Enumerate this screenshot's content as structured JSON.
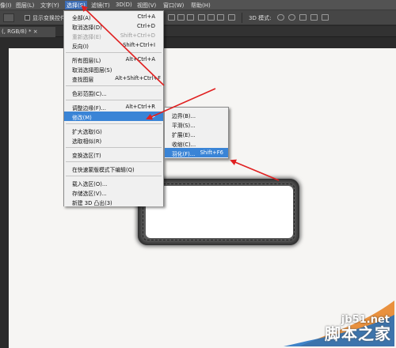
{
  "menubar": {
    "items": [
      {
        "label": "像(I)",
        "active": false
      },
      {
        "label": "图层(L)",
        "active": false
      },
      {
        "label": "文字(Y)",
        "active": false
      },
      {
        "label": "选择(S)",
        "active": true
      },
      {
        "label": "滤镜(T)",
        "active": false
      },
      {
        "label": "3D(D)",
        "active": false
      },
      {
        "label": "视图(V)",
        "active": false
      },
      {
        "label": "窗口(W)",
        "active": false
      },
      {
        "label": "帮助(H)",
        "active": false
      }
    ]
  },
  "options": {
    "show_transform": "显示变换控件",
    "mode_3d": "3D 模式:"
  },
  "document": {
    "tab_label": "(, RGB/8) * ×"
  },
  "select_menu": {
    "items": [
      {
        "label": "全部(A)",
        "shortcut": "Ctrl+A",
        "disabled": false
      },
      {
        "label": "取消选择(D)",
        "shortcut": "Ctrl+D",
        "disabled": false
      },
      {
        "label": "重新选择(E)",
        "shortcut": "Shift+Ctrl+D",
        "disabled": true
      },
      {
        "label": "反向(I)",
        "shortcut": "Shift+Ctrl+I",
        "disabled": false
      },
      {
        "label": "所有图层(L)",
        "shortcut": "Alt+Ctrl+A",
        "disabled": false
      },
      {
        "label": "取消选择图层(S)",
        "shortcut": "",
        "disabled": false
      },
      {
        "label": "查找图层",
        "shortcut": "Alt+Shift+Ctrl+F",
        "disabled": false
      },
      {
        "label": "色彩范围(C)...",
        "shortcut": "",
        "disabled": false
      },
      {
        "label": "调整边缘(F)...",
        "shortcut": "Alt+Ctrl+R",
        "disabled": false
      },
      {
        "label": "修改(M)",
        "shortcut": "",
        "disabled": false,
        "highlighted": true
      },
      {
        "label": "扩大选取(G)",
        "shortcut": "",
        "disabled": false
      },
      {
        "label": "选取相似(R)",
        "shortcut": "",
        "disabled": false
      },
      {
        "label": "变换选区(T)",
        "shortcut": "",
        "disabled": false
      },
      {
        "label": "在快速蒙版模式下编辑(Q)",
        "shortcut": "",
        "disabled": false
      },
      {
        "label": "载入选区(O)...",
        "shortcut": "",
        "disabled": false
      },
      {
        "label": "存储选区(V)...",
        "shortcut": "",
        "disabled": false
      },
      {
        "label": "新建 3D 凸出(3)",
        "shortcut": "",
        "disabled": false
      }
    ]
  },
  "modify_submenu": {
    "items": [
      {
        "label": "边界(B)...",
        "shortcut": ""
      },
      {
        "label": "平滑(S)...",
        "shortcut": ""
      },
      {
        "label": "扩展(E)...",
        "shortcut": ""
      },
      {
        "label": "收缩(C)...",
        "shortcut": ""
      },
      {
        "label": "羽化(F)...",
        "shortcut": "Shift+F6",
        "highlighted": true
      }
    ]
  },
  "watermark": {
    "site": "jb51.net",
    "brand": "脚本之家"
  },
  "colors": {
    "accent": "#3a84d6",
    "arrow": "#e02020",
    "menubar": "#535353"
  }
}
